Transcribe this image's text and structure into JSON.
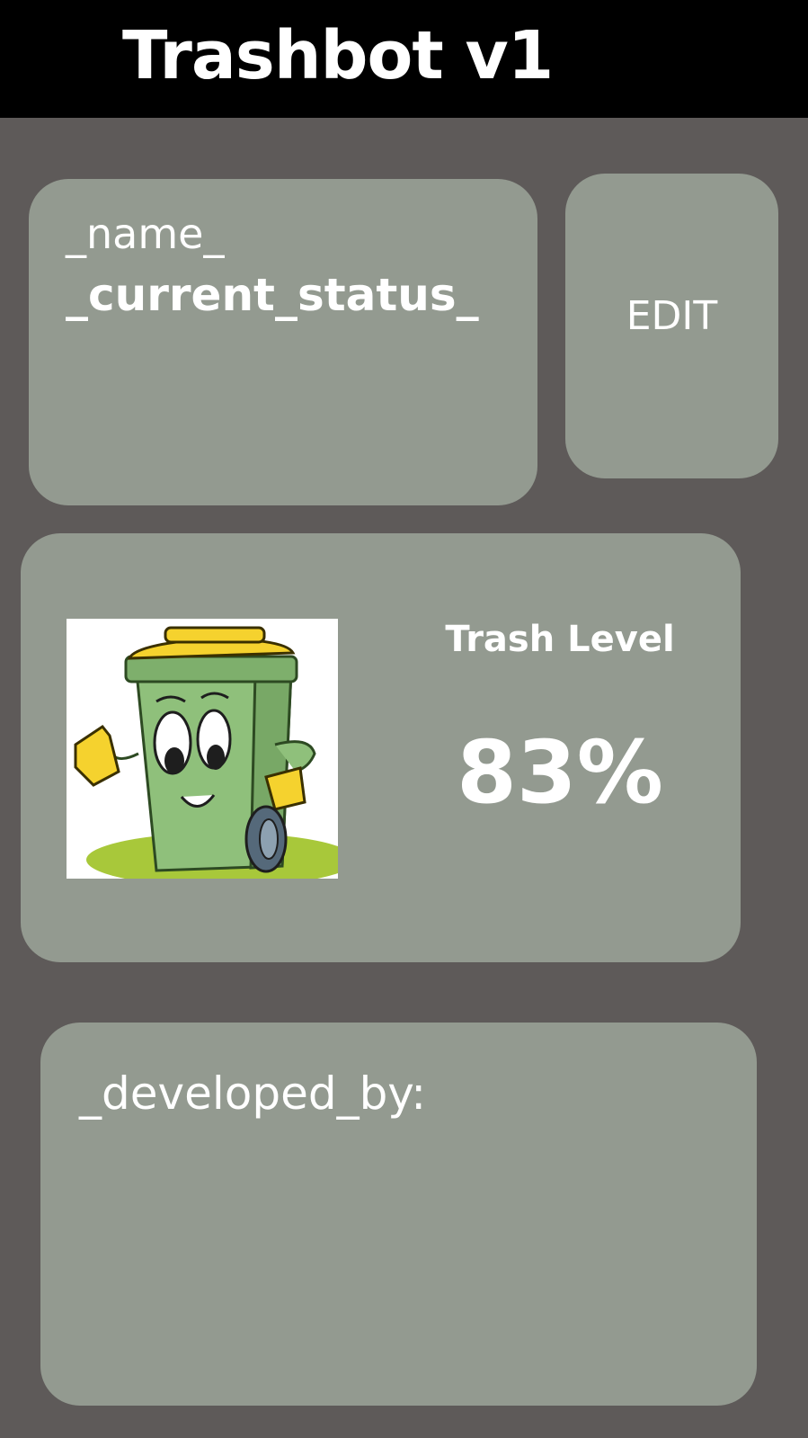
{
  "header": {
    "title": "Trashbot v1"
  },
  "info_card": {
    "name": "_name_",
    "status": "_current_status_"
  },
  "edit_button": {
    "label": "EDIT"
  },
  "trash_level_card": {
    "label": "Trash Level",
    "value": "83%",
    "image_icon": "trash-bin-mascot"
  },
  "developer_card": {
    "label": "_developed_by:"
  },
  "colors": {
    "background": "#5e5a59",
    "header": "#000000",
    "card": "#939a90",
    "text": "#ffffff"
  }
}
